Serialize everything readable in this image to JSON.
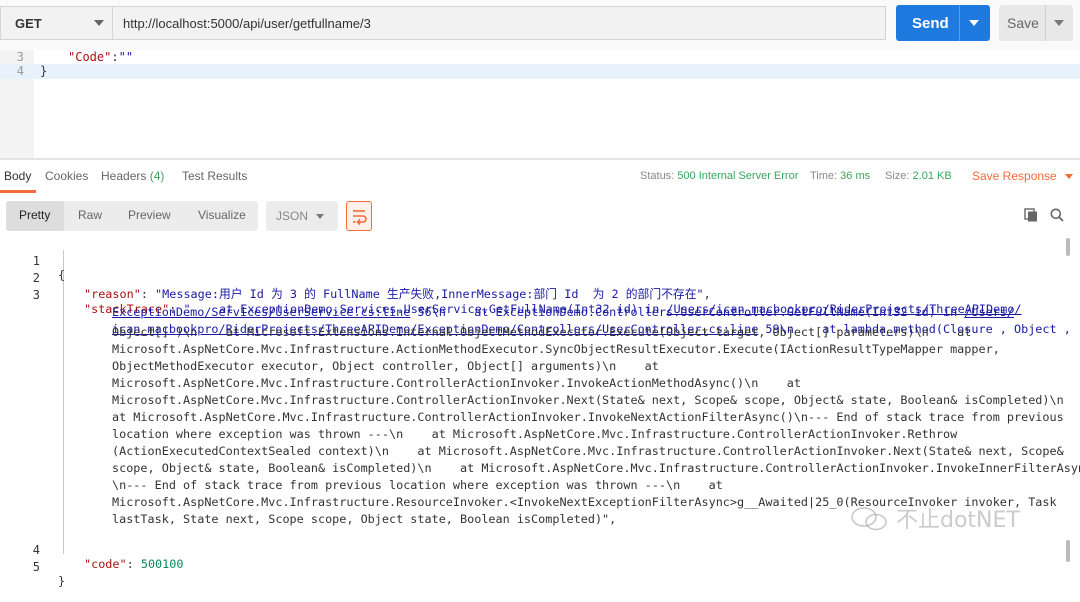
{
  "request": {
    "method": "GET",
    "url": "http://localhost:5000/api/user/getfullname/3",
    "send_label": "Send",
    "save_label": "Save"
  },
  "request_body": {
    "lines": [
      {
        "num": "3",
        "key": "\"Code\"",
        "colon": ":",
        "value": "\"\""
      },
      {
        "num": "4",
        "text": "}"
      }
    ]
  },
  "response_tabs": {
    "items": [
      "Body",
      "Cookies",
      "Headers",
      "Test Results"
    ],
    "headers_count": "(4)",
    "active": "Body"
  },
  "response_meta": {
    "status_label": "Status:",
    "status_value": "500 Internal Server Error",
    "time_label": "Time:",
    "time_value": "36 ms",
    "size_label": "Size:",
    "size_value": "2.01 KB",
    "save_response": "Save Response"
  },
  "view_modes": {
    "items": [
      "Pretty",
      "Raw",
      "Preview",
      "Visualize"
    ],
    "active": "Pretty",
    "format": "JSON"
  },
  "response_body": {
    "line_numbers": [
      "1",
      "2",
      "3",
      "4",
      "5"
    ],
    "open_brace": "{",
    "close_brace": "}",
    "reason_key": "\"reason\"",
    "reason_value": "\"Message:用户 Id 为 3 的 FullName 生产失败,InnerMessage:部门 Id  为 2 的部门不存在\"",
    "stack_key": "\"stackTrace\"",
    "stack_lines": [
      [
        "\"    at ExceptionDemo.Services.UserService.GetFullName(Int32 id) in ",
        "/Users/ican_macbookpro/RiderProjects/ThreeAPIDemo/",
        ""
      ],
      [
        "",
        "ExceptionDemo/Services/UserService.cs:line",
        " 56\\n    at ExceptionDemo.Controllers.UserController.GetFullName(Int32 id) in ",
        "/Users/"
      ],
      [
        "",
        "ican_macbookpro/RiderProjects/ThreeAPIDemo/ExceptionDemo/Controllers/UserController.cs:line",
        " 59\\n    at lambda_method(Closure , Object ,",
        ""
      ],
      [
        "Object[] )\\n    at Microsoft.Extensions.Internal.ObjectMethodExecutor.Execute(Object target, Object[] parameters)\\n    at"
      ],
      [
        "Microsoft.AspNetCore.Mvc.Infrastructure.ActionMethodExecutor.SyncObjectResultExecutor.Execute(IActionResultTypeMapper mapper,"
      ],
      [
        "ObjectMethodExecutor executor, Object controller, Object[] arguments)\\n    at"
      ],
      [
        "Microsoft.AspNetCore.Mvc.Infrastructure.ControllerActionInvoker.InvokeActionMethodAsync()\\n    at"
      ],
      [
        "Microsoft.AspNetCore.Mvc.Infrastructure.ControllerActionInvoker.Next(State& next, Scope& scope, Object& state, Boolean& isCompleted)\\n"
      ],
      [
        "at Microsoft.AspNetCore.Mvc.Infrastructure.ControllerActionInvoker.InvokeNextActionFilterAsync()\\n--- End of stack trace from previous"
      ],
      [
        "location where exception was thrown ---\\n    at Microsoft.AspNetCore.Mvc.Infrastructure.ControllerActionInvoker.Rethrow"
      ],
      [
        "(ActionExecutedContextSealed context)\\n    at Microsoft.AspNetCore.Mvc.Infrastructure.ControllerActionInvoker.Next(State& next, Scope&"
      ],
      [
        "scope, Object& state, Boolean& isCompleted)\\n    at Microsoft.AspNetCore.Mvc.Infrastructure.ControllerActionInvoker.InvokeInnerFilterAsync()"
      ],
      [
        "\\n--- End of stack trace from previous location where exception was thrown ---\\n    at"
      ],
      [
        "Microsoft.AspNetCore.Mvc.Infrastructure.ResourceInvoker.<InvokeNextExceptionFilterAsync>g__Awaited|25_0(ResourceInvoker invoker, Task"
      ],
      [
        "lastTask, State next, Scope scope, Object state, Boolean isCompleted)\","
      ]
    ],
    "code_key": "\"code\"",
    "code_value": "500100"
  },
  "watermark": "不止dotNET",
  "colors": {
    "accent": "#f26b3a",
    "send": "#1f7ae0",
    "status_ok_text": "#3aa55c",
    "key": "#aa1111",
    "string": "#1a1aa6"
  }
}
